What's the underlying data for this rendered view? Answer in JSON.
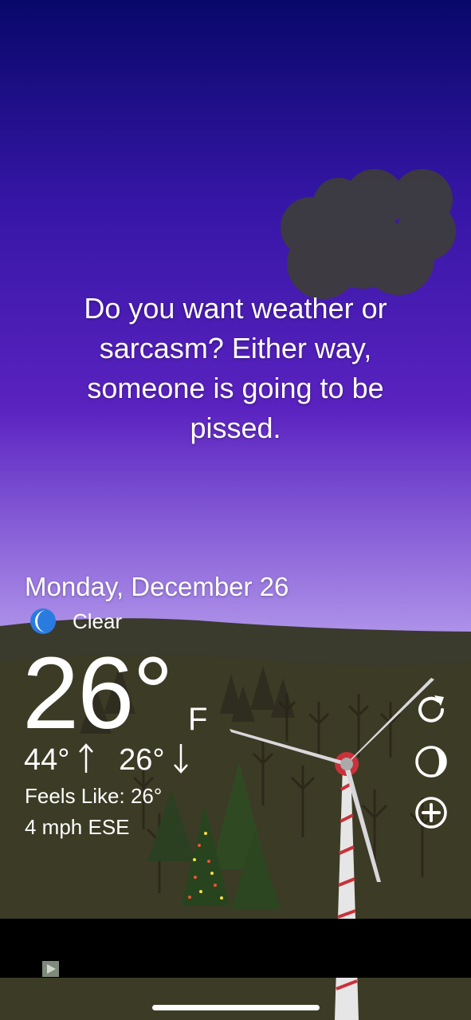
{
  "message": {
    "line1": "Do you want weather or",
    "line2": "sarcasm? Either way,",
    "line3": "someone is going to be",
    "line4": "pissed."
  },
  "weather": {
    "date": "Monday, December 26",
    "condition_icon": "crescent-moon-icon",
    "condition": "Clear",
    "temperature": "26°",
    "unit": "F",
    "high": "44°",
    "low": "26°",
    "feels_like": "Feels Like: 26°",
    "wind": "4 mph ESE"
  },
  "actions": [
    {
      "name": "refresh",
      "icon": "refresh-icon"
    },
    {
      "name": "moon-phase",
      "icon": "moon-phase-icon"
    },
    {
      "name": "add",
      "icon": "add-circle-icon"
    }
  ],
  "ad": {
    "icon": "ad-choices-icon"
  },
  "colors": {
    "sky_top": "#0a0a6b",
    "sky_mid": "#5a22c0",
    "sky_low": "#b9a1ef",
    "hills": "#3a3a2b",
    "ground": "#3f3d20",
    "moon_blue": "#2a7be0"
  }
}
